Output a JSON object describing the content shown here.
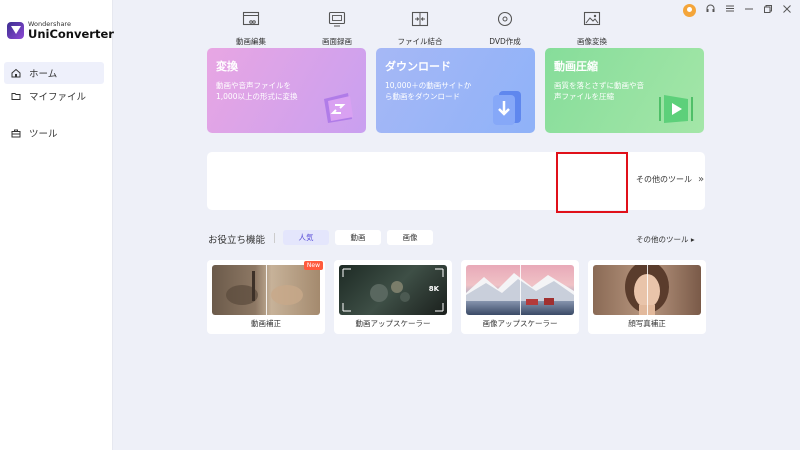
{
  "app": {
    "brand": "Wondershare",
    "product": "UniConverter"
  },
  "sidebar": {
    "items": [
      {
        "label": "ホーム",
        "icon": "home-icon",
        "active": true
      },
      {
        "label": "マイファイル",
        "icon": "folder-icon",
        "active": false
      },
      {
        "label": "ツール",
        "icon": "toolbox-icon",
        "active": false
      }
    ]
  },
  "window_controls": [
    "avatar",
    "headset-icon",
    "menu-icon",
    "minimize-icon",
    "restore-icon",
    "close-icon"
  ],
  "feature_cards": [
    {
      "title": "変換",
      "desc": "動画や音声ファイルを1,000以上の形式に変換",
      "color": "#e3a4ea"
    },
    {
      "title": "ダウンロード",
      "desc": "10,000＋の動画サイトから動画をダウンロード",
      "color": "#9fb6f6"
    },
    {
      "title": "動画圧縮",
      "desc": "画質を落とさずに動画や音声ファイルを圧縮",
      "color": "#8fe09e"
    }
  ],
  "tools": [
    {
      "label": "動画編集",
      "icon": "video-edit-icon"
    },
    {
      "label": "画面録画",
      "icon": "screen-record-icon"
    },
    {
      "label": "ファイル結合",
      "icon": "merge-icon"
    },
    {
      "label": "DVD作成",
      "icon": "dvd-icon"
    },
    {
      "label": "画像変換",
      "icon": "image-convert-icon"
    }
  ],
  "more_tools_label": "その他のツール",
  "useful": {
    "title": "お役立ち機能",
    "chips": [
      {
        "label": "人気",
        "active": true
      },
      {
        "label": "動画",
        "active": false
      },
      {
        "label": "画像",
        "active": false
      }
    ],
    "other_tools_label": "その他のツール ▸",
    "cards": [
      {
        "label": "動画補正",
        "badge": "New"
      },
      {
        "label": "動画アップスケーラー",
        "badge": "",
        "resolution": "8K"
      },
      {
        "label": "画像アップスケーラー",
        "badge": ""
      },
      {
        "label": "顔写真補正",
        "badge": ""
      }
    ]
  },
  "colors": {
    "accent": "#5a4fd8",
    "highlight": "#e0101a",
    "badge": "#ff5a3c"
  }
}
